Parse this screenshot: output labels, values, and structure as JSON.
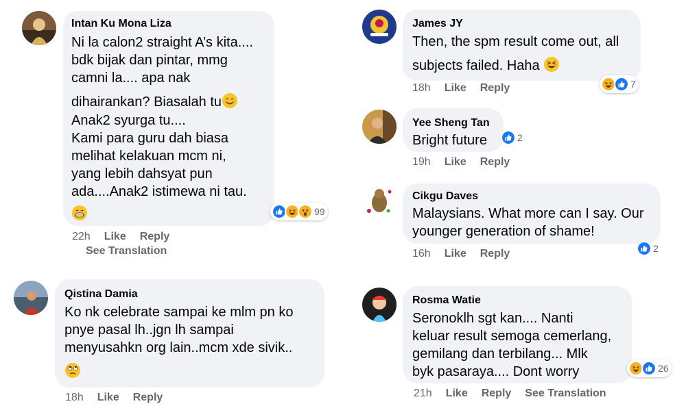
{
  "comments": [
    {
      "author": "Intan Ku Mona Liza",
      "lines": [
        "Ni la calon2 straight A’s kita....",
        "bdk bijak dan pintar, mmg",
        "camni la.... apa nak",
        "dihairankan? Biasalah tu",
        "Anak2 syurga tu....",
        "Kami para guru dah biasa",
        "melihat kelakuan mcm ni,",
        "yang lebih dahsyat pun",
        "ada....Anak2 istimewa ni tau."
      ],
      "reaction_count": "99",
      "time": "22h",
      "like": "Like",
      "reply": "Reply",
      "translation": "See Translation"
    },
    {
      "author": "Qistina Damia",
      "lines": [
        "Ko nk celebrate sampai ke mlm pn ko",
        "pnye pasal lh..jgn lh sampai",
        "menyusahkn org lain..mcm xde sivik.."
      ],
      "time": "18h",
      "like": "Like",
      "reply": "Reply"
    },
    {
      "author": "James JY",
      "lines": [
        "Then, the spm result come out, all",
        "subjects failed. Haha"
      ],
      "reaction_count": "7",
      "time": "18h",
      "like": "Like",
      "reply": "Reply"
    },
    {
      "author": "Yee Sheng Tan",
      "lines": [
        "Bright future"
      ],
      "reaction_count": "2",
      "time": "19h",
      "like": "Like",
      "reply": "Reply"
    },
    {
      "author": "Cikgu Daves",
      "lines": [
        "Malaysians. What more can I say. Our",
        "younger generation of shame!"
      ],
      "reaction_count": "2",
      "time": "16h",
      "like": "Like",
      "reply": "Reply"
    },
    {
      "author": "Rosma Watie",
      "lines": [
        "Seronoklh sgt kan....  Nanti",
        "keluar result semoga cemerlang,",
        "gemilang dan terbilang... Mlk",
        "byk pasaraya.... Dont worry"
      ],
      "reaction_count": "26",
      "time": "21h",
      "like": "Like",
      "reply": "Reply",
      "translation": "See Translation"
    }
  ],
  "colors": {
    "bubble": "#f0f2f5",
    "meta": "#65676b",
    "like_blue": "#1877f2",
    "haha_yellow": "#f7b125"
  },
  "icons": [
    "avatar",
    "smiling-face-icon",
    "grinning-face-icon",
    "rolling-eyes-icon",
    "laughing-face-icon",
    "like-reaction-icon",
    "haha-reaction-icon",
    "wow-reaction-icon"
  ]
}
